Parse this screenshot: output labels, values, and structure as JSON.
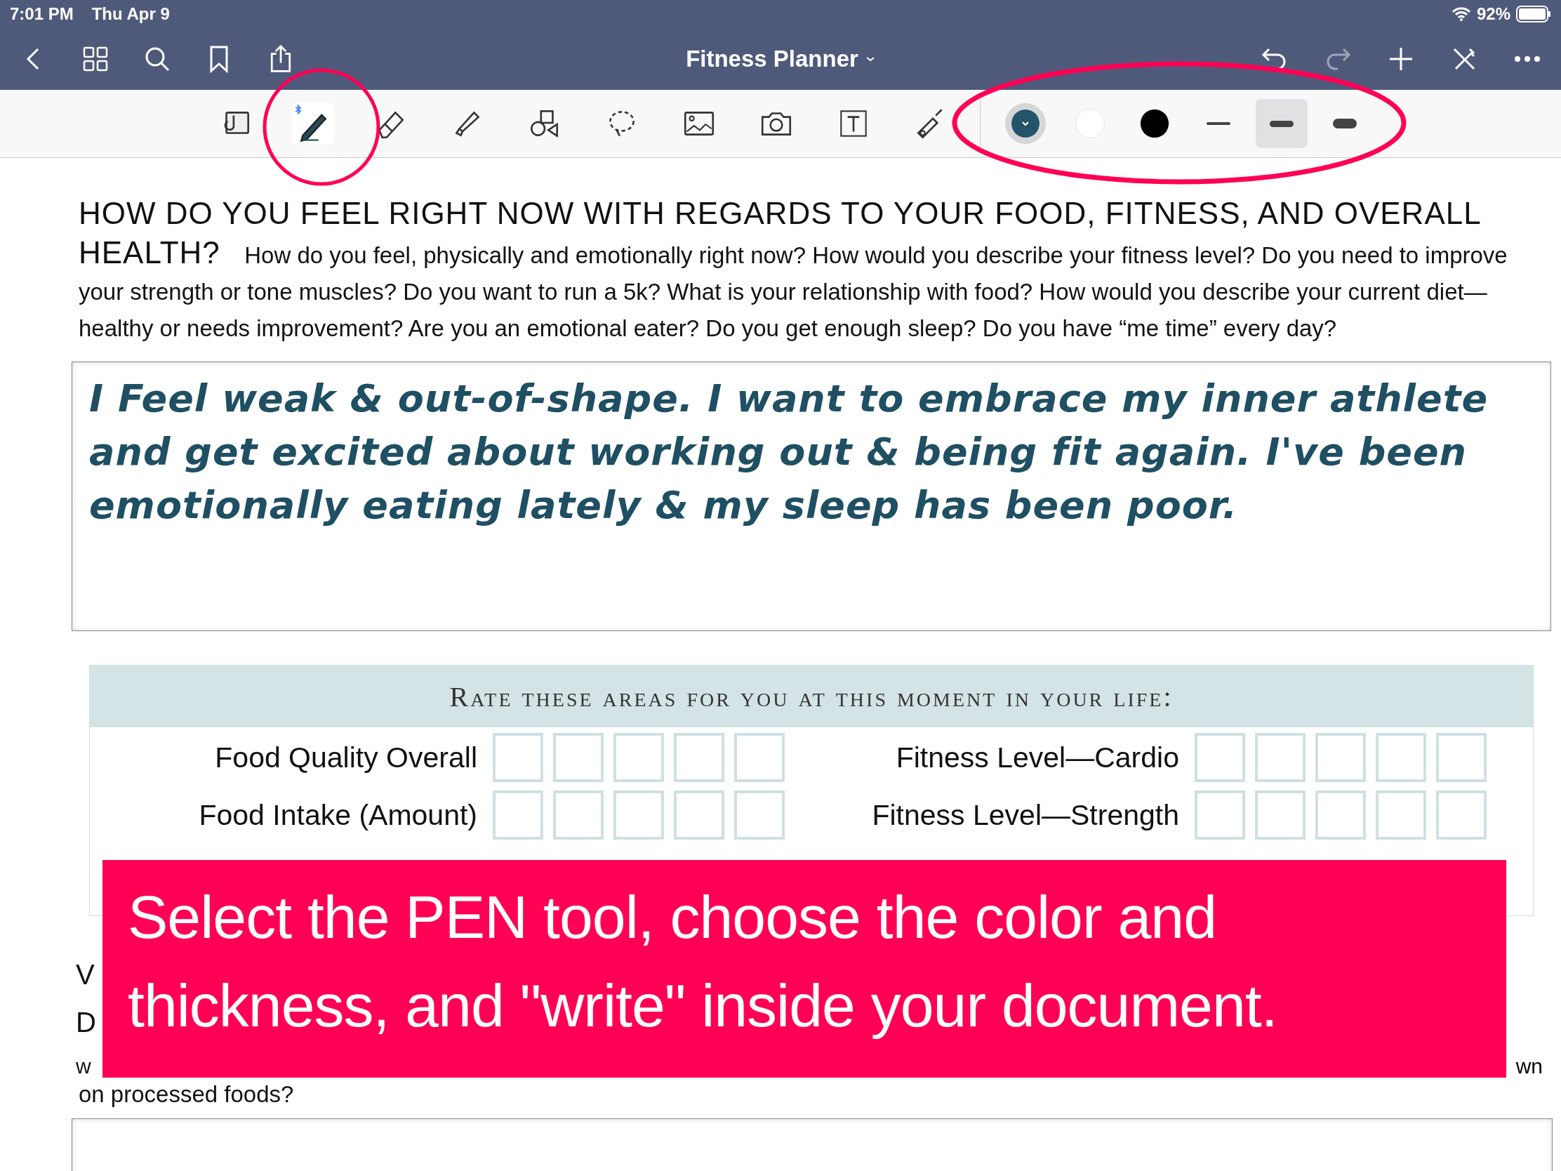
{
  "status_bar": {
    "time": "7:01 PM",
    "date": "Thu Apr 9",
    "battery": "92%"
  },
  "nav": {
    "title": "Fitness Planner"
  },
  "toolbar": {
    "tools": [
      {
        "kind": "read",
        "selected": false
      },
      {
        "kind": "pen",
        "selected": true
      },
      {
        "kind": "eraser",
        "selected": false
      },
      {
        "kind": "highlighter",
        "selected": false
      },
      {
        "kind": "shapes",
        "selected": false
      },
      {
        "kind": "lasso",
        "selected": false
      },
      {
        "kind": "image",
        "selected": false
      },
      {
        "kind": "camera",
        "selected": false
      },
      {
        "kind": "text",
        "selected": false
      },
      {
        "kind": "laser",
        "selected": false
      }
    ],
    "colors": [
      {
        "color": "#24546a",
        "selected": true
      },
      {
        "color": "#ffffff",
        "selected": false
      },
      {
        "color": "#000000",
        "selected": false
      }
    ],
    "widths": [
      {
        "kind": "thin",
        "selected": false
      },
      {
        "kind": "medium",
        "selected": true
      },
      {
        "kind": "thick",
        "selected": false
      }
    ]
  },
  "question": {
    "heading": "HOW DO YOU FEEL RIGHT NOW WITH REGARDS TO YOUR FOOD, FITNESS, AND OVERALL HEALTH?",
    "body": "How do you feel, physically and emotionally right now? How would  you describe your fitness level? Do you need to improve your strength or tone muscles? Do  you want to run a 5k? What is your relationship with food? How would you describe your current diet—healthy or needs improvement? Are you an emotional eater? Do you get enough sleep? Do you have “me time” every day?"
  },
  "answer": {
    "value": "I Feel weak & out-of-shape.  I want to embrace my inner athlete and get excited about working out & being fit again.  I've been emotionally eating lately & my sleep has been poor."
  },
  "rating": {
    "title": "Rate these areas for you at this moment in your life:",
    "items": [
      {
        "label": "Food Quality Overall",
        "boxes": [
          {
            "checked": false
          },
          {
            "checked": false
          },
          {
            "checked": false
          },
          {
            "checked": false
          },
          {
            "checked": false
          }
        ]
      },
      {
        "label": "Fitness Level—Cardio",
        "boxes": [
          {
            "checked": false
          },
          {
            "checked": false
          },
          {
            "checked": false
          },
          {
            "checked": false
          },
          {
            "checked": false
          }
        ]
      },
      {
        "label": "Food Intake (Amount)",
        "boxes": [
          {
            "checked": false
          },
          {
            "checked": false
          },
          {
            "checked": false
          },
          {
            "checked": false
          },
          {
            "checked": false
          }
        ]
      },
      {
        "label": "Fitness Level—Strength",
        "boxes": [
          {
            "checked": false
          },
          {
            "checked": false
          },
          {
            "checked": false
          },
          {
            "checked": false
          },
          {
            "checked": false
          }
        ]
      }
    ]
  },
  "next_question": {
    "left_fragments": [
      "V",
      "D",
      "w"
    ],
    "right_fragment": "wn",
    "last_line": "on processed foods?"
  },
  "banner": {
    "text": "Select the PEN tool, choose the color and thickness, and \"write\" inside your document."
  }
}
